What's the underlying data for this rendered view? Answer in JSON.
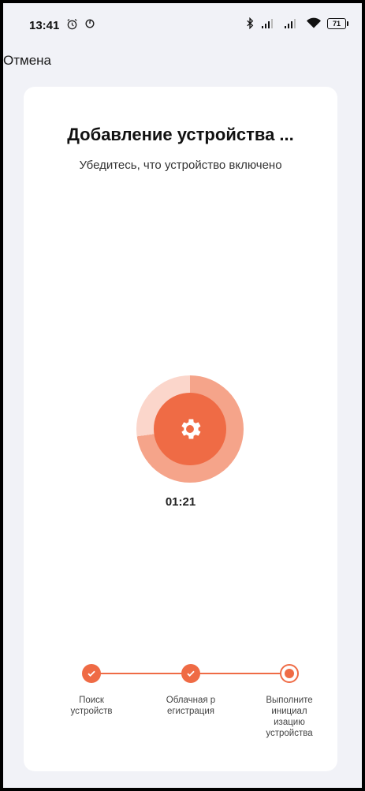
{
  "status_bar": {
    "time": "13:41",
    "battery": "71"
  },
  "header": {
    "cancel_label": "Отмена"
  },
  "card": {
    "title": "Добавление устройства ...",
    "subtitle": "Убедитесь, что устройство включено",
    "progress_icon": "gear-icon",
    "timer": "01:21"
  },
  "steps": [
    {
      "label": "Поиск\nустройств",
      "state": "done"
    },
    {
      "label": "Облачная р\nегистрация",
      "state": "done"
    },
    {
      "label": "Выполните\nинициал\nизацию\nустройства",
      "state": "active"
    }
  ],
  "colors": {
    "accent": "#ef6b45",
    "accent_light": "#f5a48a",
    "background": "#f1f2f7"
  }
}
